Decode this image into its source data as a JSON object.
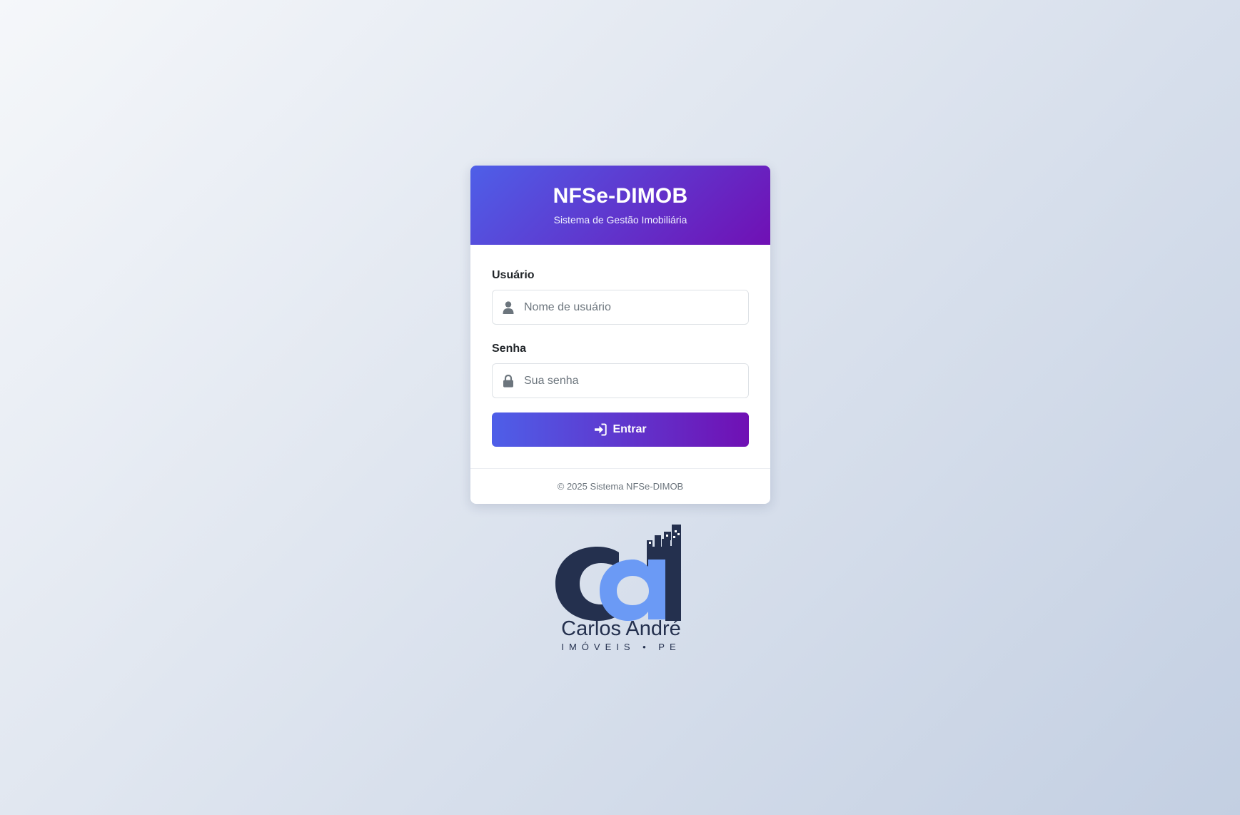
{
  "header": {
    "title": "NFSe-DIMOB",
    "subtitle": "Sistema de Gestão Imobiliária"
  },
  "form": {
    "username": {
      "label": "Usuário",
      "placeholder": "Nome de usuário",
      "value": "",
      "icon": "user-icon"
    },
    "password": {
      "label": "Senha",
      "placeholder": "Sua senha",
      "value": "",
      "icon": "lock-icon"
    },
    "submit": {
      "label": "Entrar",
      "icon": "sign-in-icon"
    }
  },
  "footer": {
    "copyright": "© 2025 Sistema NFSe-DIMOB"
  },
  "logo": {
    "name": "Carlos André",
    "tagline": "IMÓVEIS • PE"
  },
  "colors": {
    "gradient_start": "#4e5fe8",
    "gradient_end": "#7010b4",
    "logo_dark": "#24304e",
    "logo_light": "#6b9af5"
  }
}
